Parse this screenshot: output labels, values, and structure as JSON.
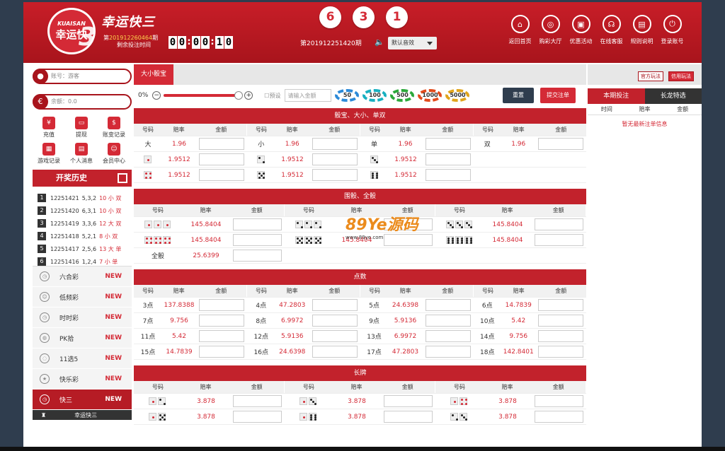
{
  "brand": {
    "circle_top": "KUAISAN",
    "circle_bottom": "幸运快",
    "circle_num": "3",
    "title": "幸运快三"
  },
  "period": {
    "prefix": "第",
    "number": "201912260464",
    "suffix": "期",
    "label": "剩余投注时间"
  },
  "timer": [
    "0",
    "0",
    "0",
    "0",
    "1",
    "0"
  ],
  "result_balls": [
    "6",
    "3",
    "1"
  ],
  "current_period": "第201912251420期",
  "sound": "默认音效",
  "nav": [
    {
      "label": "返回首页",
      "icon": "home-icon",
      "g": "⌂"
    },
    {
      "label": "购彩大厅",
      "icon": "lottery-icon",
      "g": "◎"
    },
    {
      "label": "优惠活动",
      "icon": "gift-icon",
      "g": "▣"
    },
    {
      "label": "在线客服",
      "icon": "headset-icon",
      "g": "☊"
    },
    {
      "label": "规则说明",
      "icon": "rules-icon",
      "g": "▤"
    },
    {
      "label": "登录账号",
      "icon": "power-icon",
      "g": "⏻"
    }
  ],
  "account": {
    "user": "账号：游客",
    "balance": "余额：0.0"
  },
  "quick": [
    {
      "label": "充值",
      "icon": "yuan-icon",
      "g": "¥"
    },
    {
      "label": "提现",
      "icon": "wallet-icon",
      "g": "▭"
    },
    {
      "label": "账变记录",
      "icon": "ledger-icon",
      "g": "$"
    },
    {
      "label": "游戏记录",
      "icon": "game-record-icon",
      "g": "▦"
    },
    {
      "label": "个人消息",
      "icon": "message-icon",
      "g": "▤"
    },
    {
      "label": "会员中心",
      "icon": "member-icon",
      "g": "☺"
    }
  ],
  "history_title": "开奖历史",
  "history": [
    {
      "n": "1",
      "id": "12251421",
      "nums": "5,3,2",
      "res": "10 小 双"
    },
    {
      "n": "2",
      "id": "12251420",
      "nums": "6,3,1",
      "res": "10 小 双"
    },
    {
      "n": "3",
      "id": "12251419",
      "nums": "3,3,6",
      "res": "12 大 双"
    },
    {
      "n": "4",
      "id": "12251418",
      "nums": "5,2,1",
      "res": "8 小 双"
    },
    {
      "n": "5",
      "id": "12251417",
      "nums": "2,5,6",
      "res": "13 大 单"
    },
    {
      "n": "6",
      "id": "12251416",
      "nums": "1,2,4",
      "res": "7 小 单"
    }
  ],
  "lotteries": [
    {
      "name": "六合彩",
      "badge": "NEW",
      "icon": "clock-icon",
      "g": "◷"
    },
    {
      "name": "低频彩",
      "badge": "NEW",
      "icon": "smile-icon",
      "g": "☺"
    },
    {
      "name": "时时彩",
      "badge": "NEW",
      "icon": "clock-icon",
      "g": "◷"
    },
    {
      "name": "PK拾",
      "badge": "NEW",
      "icon": "globe-icon",
      "g": "◍"
    },
    {
      "name": "11选5",
      "badge": "NEW",
      "icon": "controller-icon",
      "g": "◌"
    },
    {
      "name": "快乐彩",
      "badge": "NEW",
      "icon": "star-icon",
      "g": "★"
    },
    {
      "name": "快三",
      "badge": "NEW",
      "icon": "clock-icon",
      "g": "◷"
    }
  ],
  "subitem": {
    "icon": "trophy-icon",
    "label": "幸运快三"
  },
  "tab": "大小骰宝",
  "toolbar": {
    "pct": "0%",
    "minus": "−",
    "plus": "+",
    "preset": "预设",
    "amount_placeholder": "请输入金额",
    "reset": "重置",
    "submit": "提交注单"
  },
  "chips": [
    {
      "v": "50",
      "c": "#2c8ad8"
    },
    {
      "v": "100",
      "c": "#18b0c0"
    },
    {
      "v": "500",
      "c": "#2ba83a"
    },
    {
      "v": "1000",
      "c": "#e24a1b"
    },
    {
      "v": "5000",
      "c": "#e0a41c"
    }
  ],
  "headers": {
    "code": "号码",
    "odds": "赔率",
    "amount": "金额"
  },
  "sec1": {
    "title": "骰宝、大小、单双",
    "row1": [
      {
        "code": "大",
        "odds": "1.96"
      },
      {
        "code": "小",
        "odds": "1.96"
      },
      {
        "code": "单",
        "odds": "1.96"
      },
      {
        "code": "双",
        "odds": "1.96"
      }
    ],
    "row2": [
      {
        "pips": 1,
        "odds": "1.9512"
      },
      {
        "pips": 2,
        "odds": "1.9512"
      },
      {
        "pips": 3,
        "odds": "1.9512"
      }
    ],
    "row3": [
      {
        "pips": 4,
        "odds": "1.9512"
      },
      {
        "pips": 5,
        "odds": "1.9512"
      },
      {
        "pips": 6,
        "odds": "1.9512"
      }
    ]
  },
  "sec2": {
    "title": "围骰、全骰",
    "rows": [
      [
        {
          "pips": 1,
          "odds": "145.8404"
        },
        {
          "pips": 2,
          "odds": ""
        },
        {
          "pips": 3,
          "odds": "145.8404"
        }
      ],
      [
        {
          "pips": 4,
          "odds": "145.8404"
        },
        {
          "pips": 5,
          "odds": "145.8404"
        },
        {
          "pips": 6,
          "odds": "145.8404"
        }
      ]
    ],
    "all": {
      "code": "全骰",
      "odds": "25.6399"
    }
  },
  "sec3": {
    "title": "点数",
    "rows": [
      [
        {
          "code": "3点",
          "odds": "137.8388"
        },
        {
          "code": "4点",
          "odds": "47.2803"
        },
        {
          "code": "5点",
          "odds": "24.6398"
        },
        {
          "code": "6点",
          "odds": "14.7839"
        }
      ],
      [
        {
          "code": "7点",
          "odds": "9.756"
        },
        {
          "code": "8点",
          "odds": "6.9972"
        },
        {
          "code": "9点",
          "odds": "5.9136"
        },
        {
          "code": "10点",
          "odds": "5.42"
        }
      ],
      [
        {
          "code": "11点",
          "odds": "5.42"
        },
        {
          "code": "12点",
          "odds": "5.9136"
        },
        {
          "code": "13点",
          "odds": "6.9972"
        },
        {
          "code": "14点",
          "odds": "9.756"
        }
      ],
      [
        {
          "code": "15点",
          "odds": "14.7839"
        },
        {
          "code": "16点",
          "odds": "24.6398"
        },
        {
          "code": "17点",
          "odds": "47.2803"
        },
        {
          "code": "18点",
          "odds": "142.8401"
        }
      ]
    ]
  },
  "sec4": {
    "title": "长牌",
    "rows": [
      [
        {
          "a": 1,
          "b": 2,
          "odds": "3.878"
        },
        {
          "a": 1,
          "b": 3,
          "odds": "3.878"
        },
        {
          "a": 1,
          "b": 4,
          "odds": "3.878"
        }
      ],
      [
        {
          "a": 1,
          "b": 5,
          "odds": "3.878"
        },
        {
          "a": 1,
          "b": 6,
          "odds": "3.878"
        },
        {
          "a": 2,
          "b": 3,
          "odds": "3.878"
        }
      ]
    ]
  },
  "right": {
    "mode1": "官方玩法",
    "mode2": "信用玩法",
    "tab1": "本期投注",
    "tab2": "长龙特选",
    "col1": "时间",
    "col2": "赔率",
    "col3": "金额",
    "empty": "暂无最新注单信息"
  },
  "watermark": {
    "text": "89Ye源码",
    "sub": "www.89ye.com"
  }
}
